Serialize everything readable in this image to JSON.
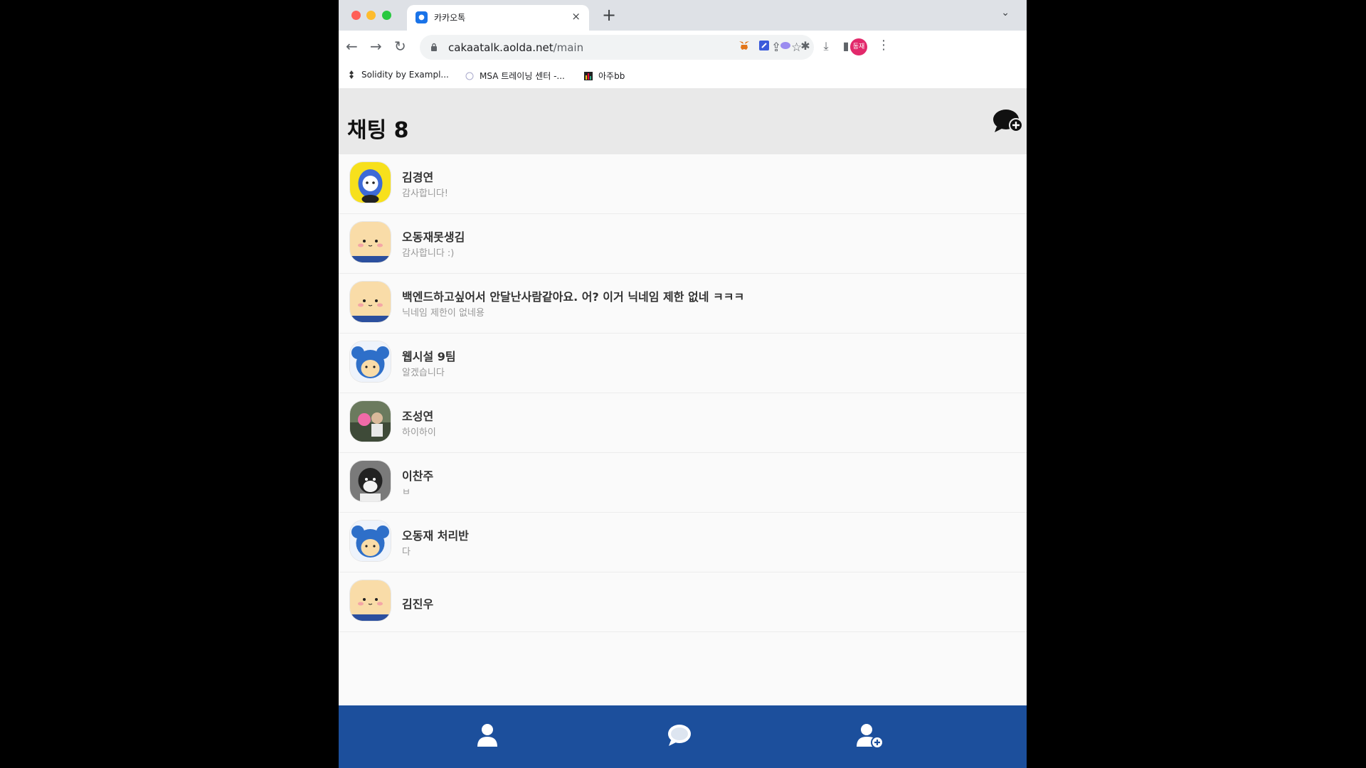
{
  "browser": {
    "tab_title": "카카오톡",
    "tab_close": "×",
    "new_tab": "+",
    "tab_menu": "⌄",
    "url_host": "cakaatalk.aolda.net",
    "url_path": "/main",
    "profile_initials": "동재",
    "bookmarks": [
      {
        "label": "Solidity by Exampl...",
        "icon": "solidity-icon"
      },
      {
        "label": "MSA 트레이닝 센터 -...",
        "icon": "msa-icon"
      },
      {
        "label": "아주bb",
        "icon": "chart-icon"
      }
    ]
  },
  "header": {
    "title": "채팅 8",
    "new_chat_icon": "chat-plus-icon"
  },
  "chats": [
    {
      "name": "김경연",
      "message": "감사합니다!",
      "avatar": "yellow-character"
    },
    {
      "name": "오동재못생김",
      "message": "감사합니다 :)",
      "avatar": "cream-character"
    },
    {
      "name": "백엔드하고싶어서 안달난사람같아요. 어? 이거 닉네임 제한 없네 ㅋㅋㅋ",
      "message": "닉네임 제한이 없네용",
      "avatar": "cream-character"
    },
    {
      "name": "웹시설 9팀",
      "message": "알겠습니다",
      "avatar": "blue-character"
    },
    {
      "name": "조성연",
      "message": "하이하이",
      "avatar": "photo"
    },
    {
      "name": "이찬주",
      "message": "ㅂ",
      "avatar": "dark-character"
    },
    {
      "name": "오동재 처리반",
      "message": "다",
      "avatar": "blue-character"
    },
    {
      "name": "김진우",
      "message": "",
      "avatar": "cream-character"
    }
  ],
  "bottom_nav": {
    "items": [
      "friends-icon",
      "chat-icon",
      "add-friend-icon"
    ],
    "color": "#1c4f9c"
  }
}
